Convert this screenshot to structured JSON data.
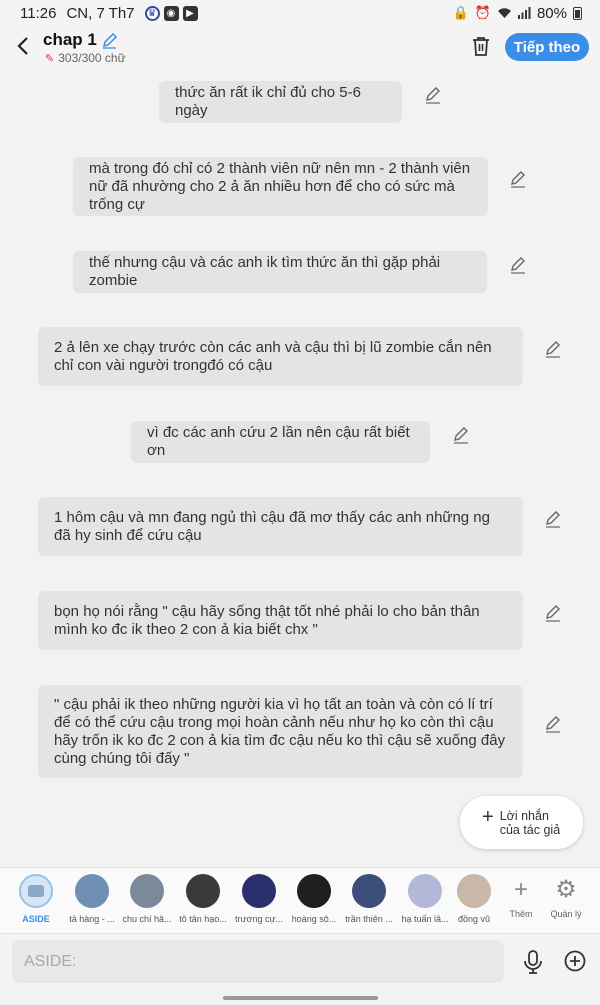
{
  "status": {
    "time": "11:26",
    "date": "CN, 7 Th7",
    "battery": "80%"
  },
  "header": {
    "title": "chap 1",
    "char_count": "303/300 chữ",
    "next_label": "Tiếp theo"
  },
  "messages": [
    {
      "text": "thức ăn rất ik chỉ đủ cho 5-6 ngày"
    },
    {
      "text": "mà trong đó chỉ có 2 thành viên nữ nên mn - 2 thành viên nữ đã nhường cho 2 ả ăn nhiều hơn để cho có sức mà trống cự"
    },
    {
      "text": "thế nhưng cậu và các anh ik tìm thức ăn thì gặp phải zombie"
    },
    {
      "text": "2 ả lên xe chạy trước còn các anh và cậu thì bị lũ zombie cắn nên chỉ con vài người trongđó có cậu"
    },
    {
      "text": "vì đc các anh cứu 2 lần nên cậu rất biết ơn"
    },
    {
      "text": "1 hôm cậu và mn đang ngủ thì cậu đã mơ thấy các anh những ng đã hy sinh để cứu cậu"
    },
    {
      "text": "bọn họ nói rằng \" cậu hãy sống thật tốt nhé phải lo cho bản thân mình ko đc ik theo 2 con ả kia biết chx \""
    },
    {
      "text": "\" cậu phải ik theo những người kia vì họ tất an toàn và còn có lí trí để có thể cứu cậu trong mọi hoàn cảnh nếu như họ ko còn thì cậu hãy trốn ik ko đc 2 con ả kia tìm đc cậu nếu ko thì cậu sẽ xuống đây cùng chúng tôi đấy \""
    }
  ],
  "note_button": {
    "line1": "Lời nhắn",
    "line2": "của tác giả"
  },
  "characters": [
    {
      "name": "ASIDE",
      "color": "#d7e6f5"
    },
    {
      "name": "tả hàng - ...",
      "color": "#6f8fb5"
    },
    {
      "name": "chu chí hâ...",
      "color": "#7a8a9a"
    },
    {
      "name": "tô tân hạo...",
      "color": "#3a3a3a"
    },
    {
      "name": "trương cự...",
      "color": "#2b2f6e"
    },
    {
      "name": "hoàng sô...",
      "color": "#1f1f1f"
    },
    {
      "name": "trần thiên ...",
      "color": "#3d4e7a"
    },
    {
      "name": "hạ tuấn lâ...",
      "color": "#b3b8d8"
    },
    {
      "name": "đồng vũ",
      "color": "#c9b7a8"
    }
  ],
  "tools": {
    "more_label": "Thêm",
    "manage_label": "Quản lý"
  },
  "input": {
    "placeholder": "ASIDE:"
  }
}
